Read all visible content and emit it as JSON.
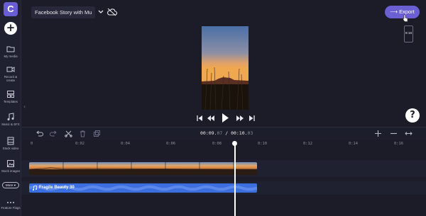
{
  "app": {
    "logo_letter": "C"
  },
  "sidebar": {
    "add_label": "+",
    "items": [
      {
        "label": "My media",
        "icon": "folder-icon"
      },
      {
        "label": "Record & create",
        "icon": "camera-icon"
      },
      {
        "label": "Templates",
        "icon": "templates-icon"
      },
      {
        "label": "Music & SFX",
        "icon": "music-icon"
      },
      {
        "label": "Stock video",
        "icon": "film-icon"
      },
      {
        "label": "Stock images",
        "icon": "image-icon"
      }
    ],
    "more_label": "More ▾",
    "feature_flags_label": "Feature Flags"
  },
  "header": {
    "project_title": "Facebook Story with Mu",
    "export_label": "⟶ Export",
    "aspect_label": "9:16"
  },
  "playback": {
    "help_label": "?"
  },
  "timeline": {
    "timecode_current_a": "00:09.",
    "timecode_current_b": "07",
    "timecode_sep": " / ",
    "timecode_total_a": "00:10.",
    "timecode_total_b": "03",
    "ruler_ticks": [
      "0",
      "0:02",
      "0:04",
      "0:06",
      "0:08",
      "0:10",
      "0:12",
      "0:14",
      "0:16"
    ],
    "audio_clip_label": "Fragile Beauty 30",
    "playhead_seconds": 9.07
  },
  "colors": {
    "accent": "#6b5fd4",
    "audio_clip": "#3b6fe0",
    "background": "#1b1c27"
  }
}
